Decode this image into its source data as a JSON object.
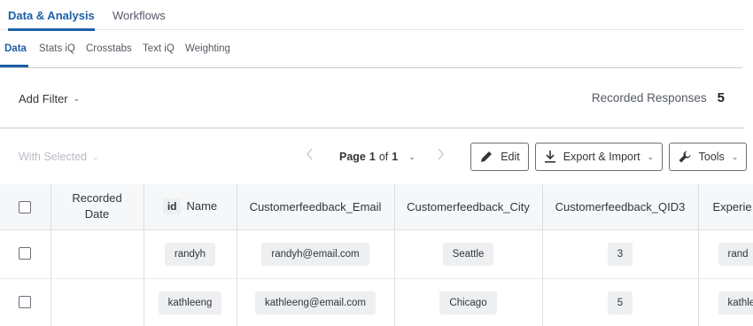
{
  "top_tabs": [
    {
      "label": "Data & Analysis",
      "active": true
    },
    {
      "label": "Workflows",
      "active": false
    }
  ],
  "sub_tabs": [
    {
      "label": "Data",
      "active": true
    },
    {
      "label": "Stats iQ",
      "active": false
    },
    {
      "label": "Crosstabs",
      "active": false
    },
    {
      "label": "Text iQ",
      "active": false
    },
    {
      "label": "Weighting",
      "active": false
    }
  ],
  "filter_bar": {
    "add_filter_label": "Add Filter",
    "responses_label": "Recorded Responses",
    "responses_count": "5"
  },
  "toolbar": {
    "with_selected_label": "With Selected",
    "page_prefix": "Page",
    "page_current": "1",
    "page_of": "of",
    "page_total": "1",
    "edit_label": "Edit",
    "export_label": "Export & Import",
    "tools_label": "Tools"
  },
  "table": {
    "id_badge": "id",
    "columns": [
      "Recorded Date",
      "Name",
      "Customerfeedback_Email",
      "Customerfeedback_City",
      "Customerfeedback_QID3",
      "Experie"
    ],
    "rows": [
      {
        "recorded_date": "",
        "name": "randyh",
        "email": "randyh@email.com",
        "city": "Seattle",
        "qid3": "3",
        "experience": "rand"
      },
      {
        "recorded_date": "",
        "name": "kathleeng",
        "email": "kathleeng@email.com",
        "city": "Chicago",
        "qid3": "5",
        "experience": "kathle"
      }
    ]
  },
  "colors": {
    "accent": "#1d5fa8",
    "header_bg": "#f6f7f8",
    "chip_bg": "#eeeff1",
    "border": "#dcdee1"
  },
  "icons": [
    "chevron-down-icon",
    "chevron-left-icon",
    "chevron-right-icon",
    "pencil-icon",
    "download-icon",
    "wrench-icon",
    "checkbox-icon"
  ]
}
